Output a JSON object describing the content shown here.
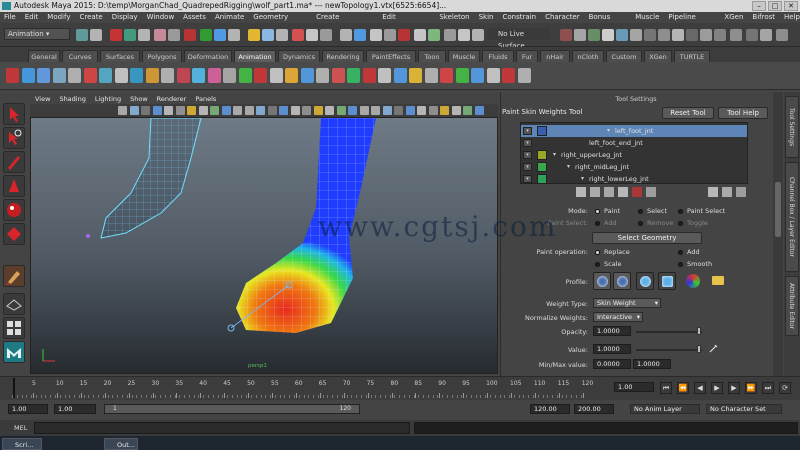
{
  "window": {
    "title": "Autodesk Maya 2015: D:\\temp\\MorganChad_QuadrepedRigging\\wolf_part1.ma*   ---   newTopology1.vtx[6525:6654]..."
  },
  "menu": [
    "File",
    "Edit",
    "Modify",
    "Create",
    "Display",
    "Window",
    "Assets",
    "Animate",
    "Geometry Cache",
    "Create Deformers",
    "Edit Deformers",
    "Skeleton",
    "Skin",
    "Constrain",
    "Character",
    "Bonus Tools",
    "Muscle",
    "Pipeline Cache",
    "XGen",
    "Bifrost",
    "Help"
  ],
  "status": {
    "mode": "Animation",
    "live_surface": "No Live Surface"
  },
  "shelf_tabs": [
    {
      "label": "General",
      "active": false
    },
    {
      "label": "Curves",
      "active": false
    },
    {
      "label": "Surfaces",
      "active": false
    },
    {
      "label": "Polygons",
      "active": false
    },
    {
      "label": "Deformation",
      "active": false
    },
    {
      "label": "Animation",
      "active": true
    },
    {
      "label": "Dynamics",
      "active": false
    },
    {
      "label": "Rendering",
      "active": false
    },
    {
      "label": "PaintEffects",
      "active": false
    },
    {
      "label": "Toon",
      "active": false
    },
    {
      "label": "Muscle",
      "active": false
    },
    {
      "label": "Fluids",
      "active": false
    },
    {
      "label": "Fur",
      "active": false
    },
    {
      "label": "nHair",
      "active": false
    },
    {
      "label": "nCloth",
      "active": false
    },
    {
      "label": "Custom",
      "active": false
    },
    {
      "label": "XGen",
      "active": false
    },
    {
      "label": "TURTLE",
      "active": false
    }
  ],
  "viewport": {
    "menu": [
      "View",
      "Shading",
      "Lighting",
      "Show",
      "Renderer",
      "Panels"
    ],
    "camera": "persp1"
  },
  "tool_settings": {
    "header": "Tool Settings",
    "tool_name": "Paint Skin Weights Tool",
    "reset_label": "Reset Tool",
    "help_label": "Tool Help",
    "influences": [
      {
        "name": "left_foot_jnt",
        "indent": 1,
        "selected": true,
        "color": "#3a5fae",
        "caret": "down"
      },
      {
        "name": "left_foot_end_jnt",
        "indent": 2,
        "selected": false,
        "color": "",
        "caret": ""
      },
      {
        "name": "right_upperLeg_jnt",
        "indent": 0,
        "selected": false,
        "color": "#9aa82a",
        "caret": "down"
      },
      {
        "name": "right_midLeg_jnt",
        "indent": 1,
        "selected": false,
        "color": "#3aa84a",
        "caret": "down"
      },
      {
        "name": "right_lowerLeg_jnt",
        "indent": 2,
        "selected": false,
        "color": "#2ea05a",
        "caret": "down"
      }
    ],
    "mode_label": "Mode:",
    "mode_options": [
      "Paint",
      "Select",
      "Paint Select"
    ],
    "paint_select_label": "Paint Select:",
    "paint_select_options": [
      "Add",
      "Remove",
      "Toggle"
    ],
    "select_geometry_label": "Select Geometry",
    "paint_op_label": "Paint operation:",
    "paint_op_options": [
      "Replace",
      "Add",
      "Scale",
      "Smooth"
    ],
    "profile_label": "Profile:",
    "weight_type_label": "Weight Type:",
    "weight_type_value": "Skin Weight",
    "normalize_label": "Normalize Weights:",
    "normalize_value": "Interactive",
    "opacity_label": "Opacity:",
    "opacity_value": "1.0000",
    "value_label": "Value:",
    "value_value": "1.0000",
    "minmax_label": "Min/Max value:",
    "min_value": "0.0000",
    "max_value": "1.0000"
  },
  "side_tabs": [
    "Tool Settings",
    "Channel Box / Layer Editor",
    "Attribute Editor"
  ],
  "timeline": {
    "ticks": [
      "5",
      "10",
      "15",
      "20",
      "25",
      "30",
      "35",
      "40",
      "45",
      "50",
      "55",
      "60",
      "65",
      "70",
      "75",
      "80",
      "85",
      "90",
      "95",
      "100",
      "105",
      "110",
      "115",
      "120"
    ],
    "current_frame": "1.00"
  },
  "range": {
    "start": "1.00",
    "playback_start": "1.00",
    "slider_value": "1",
    "slider_end": "120",
    "playback_end": "120.00",
    "end": "200.00",
    "anim_layer": "No Anim Layer",
    "character_set": "No Character Set"
  },
  "command": {
    "label": "MEL"
  },
  "taskbar": [
    "Scri...",
    "Out..."
  ],
  "watermark": "www.cgtsj.com",
  "colors": {
    "accent_selected": "#5d86b7",
    "heatmap_red": "#e8281e",
    "heatmap_blue": "#1f3cff",
    "wire_cyan": "#6fe0ff"
  }
}
